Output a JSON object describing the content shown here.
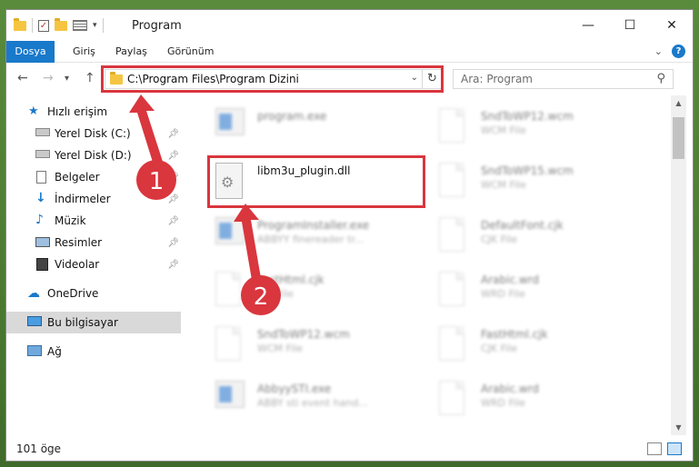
{
  "window": {
    "title": "Program",
    "controls": {
      "minimize": "—",
      "maximize": "☐",
      "close": "✕"
    }
  },
  "ribbon": {
    "tabs": [
      "Dosya",
      "Giriş",
      "Paylaş",
      "Görünüm"
    ],
    "help": "?"
  },
  "navigation": {
    "back": "←",
    "forward": "→",
    "recent": "▾",
    "up": "↑",
    "address": "C:\\Program Files\\Program Dizini",
    "refresh": "↻",
    "search_placeholder": "Ara: Program"
  },
  "sidebar": {
    "items": [
      {
        "label": "Hızlı erişim",
        "icon": "star-icon",
        "pinned": false
      },
      {
        "label": "Yerel Disk (C:)",
        "icon": "drive-icon",
        "pinned": true
      },
      {
        "label": "Yerel Disk (D:)",
        "icon": "drive-icon",
        "pinned": true
      },
      {
        "label": "Belgeler",
        "icon": "documents-icon",
        "pinned": true
      },
      {
        "label": "İndirmeler",
        "icon": "downloads-icon",
        "pinned": true
      },
      {
        "label": "Müzik",
        "icon": "music-icon",
        "pinned": true
      },
      {
        "label": "Resimler",
        "icon": "pictures-icon",
        "pinned": true
      },
      {
        "label": "Videolar",
        "icon": "videos-icon",
        "pinned": true
      },
      {
        "label": "OneDrive",
        "icon": "cloud-icon",
        "pinned": false
      },
      {
        "label": "Bu bilgisayar",
        "icon": "computer-icon",
        "pinned": false,
        "selected": true
      },
      {
        "label": "Ağ",
        "icon": "network-icon",
        "pinned": false
      }
    ]
  },
  "files": [
    {
      "name": "program.exe",
      "type": "",
      "kind": "setup",
      "blurred": true
    },
    {
      "name": "SndToWP12.wcm",
      "type": "WCM File",
      "kind": "doc",
      "blurred": true
    },
    {
      "name": "libm3u_plugin.dll",
      "type": "",
      "kind": "dll",
      "blurred": false
    },
    {
      "name": "SndToWP15.wcm",
      "type": "WCM File",
      "kind": "doc",
      "blurred": true
    },
    {
      "name": "ProgramInstaller.exe",
      "type": "ABBYY finereader tr...",
      "kind": "exe",
      "blurred": true
    },
    {
      "name": "DefaultFont.cjk",
      "type": "CJK File",
      "kind": "doc",
      "blurred": true
    },
    {
      "name": "FastHtml.cjk",
      "type": "CJK File",
      "kind": "doc",
      "blurred": true
    },
    {
      "name": "Arabic.wrd",
      "type": "WRD File",
      "kind": "doc",
      "blurred": true
    },
    {
      "name": "SndToWP12.wcm",
      "type": "WCM File",
      "kind": "doc",
      "blurred": true
    },
    {
      "name": "FastHtml.cjk",
      "type": "CJK File",
      "kind": "doc",
      "blurred": true
    },
    {
      "name": "AbbyySTI.exe",
      "type": "ABBY sti event hand...",
      "kind": "exe",
      "blurred": true
    },
    {
      "name": "Arabic.wrd",
      "type": "WRD File",
      "kind": "doc",
      "blurred": true
    }
  ],
  "scrollbar": {
    "up": "▲",
    "down": "▼"
  },
  "status": {
    "item_count": "101 öge"
  },
  "annotations": {
    "step1": "1",
    "step2": "2",
    "color": "#d9363e"
  }
}
